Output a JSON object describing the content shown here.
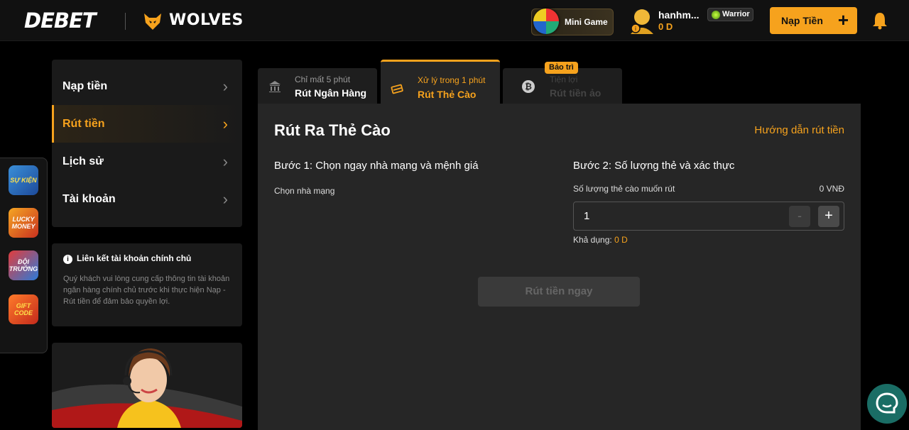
{
  "header": {
    "logo": "DEBET",
    "partner": "WOLVES",
    "minigame_label": "Mini Game",
    "username": "hanhm...",
    "balance": "0 D",
    "rank": "Warrior",
    "deposit_label": "Nạp Tiền",
    "deposit_plus": "+"
  },
  "sidebar": {
    "items": [
      {
        "label": "Nạp tiền",
        "active": false
      },
      {
        "label": "Rút tiền",
        "active": true
      },
      {
        "label": "Lịch sử",
        "active": false
      },
      {
        "label": "Tài khoản",
        "active": false
      }
    ],
    "chevron": "›"
  },
  "notice": {
    "title": "Liên kết tài khoản chính chủ",
    "body": "Quý khách vui lòng cung cấp thông tin tài khoản ngân hàng chính chủ trước khi thực hiện Nạp - Rút tiền để đảm bảo quyền lợi."
  },
  "float_icons": [
    {
      "name": "Sự Kiện",
      "label": "SỰ KIỆN"
    },
    {
      "name": "Lucky Money",
      "label": "LUCKY MONEY"
    },
    {
      "name": "Đội Trưởng",
      "label": "ĐỘI TRƯỞNG"
    },
    {
      "name": "Gift Code",
      "label": "GIFT CODE"
    }
  ],
  "tabs": [
    {
      "sub": "Chỉ mất 5 phút",
      "main": "Rút Ngân Hàng",
      "icon": "bank-icon",
      "state": "normal"
    },
    {
      "sub": "Xử lý trong 1 phút",
      "main": "Rút Thẻ Cào",
      "icon": "card-icon",
      "state": "active"
    },
    {
      "sub": "Tiện lợi",
      "main": "Rút tiền ảo",
      "icon": "bitcoin-icon",
      "state": "disabled",
      "badge": "Bảo trì"
    }
  ],
  "panel": {
    "title": "Rút Ra Thẻ Cào",
    "guide_link": "Hướng dẫn rút tiền",
    "step1": "Bước 1: Chọn ngay nhà mạng và mệnh giá",
    "carrier_label": "Chọn nhà mạng",
    "step2": "Bước 2: Số lượng thẻ và xác thực",
    "qty_label": "Số lượng thẻ cào muốn rút",
    "qty_total": "0 VNĐ",
    "qty_value": "1",
    "qty_minus": "-",
    "qty_plus": "+",
    "avail_label": "Khả dụng:",
    "avail_value": "0 D",
    "submit_label": "Rút tiền ngay"
  },
  "colors": {
    "accent": "#f6a21d",
    "background": "#000000",
    "panel": "#262626",
    "chat": "#1a6d65"
  }
}
